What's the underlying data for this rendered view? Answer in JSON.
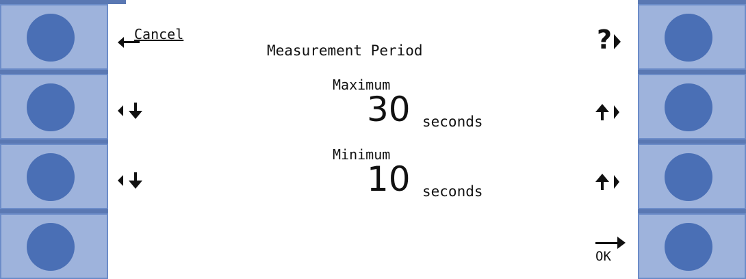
{
  "screen": {
    "cancel_label": "Cancel",
    "title": "Measurement Period",
    "ok_label": "OK",
    "help_label": "?"
  },
  "maximum": {
    "label": "Maximum",
    "value": "30",
    "unit": "seconds"
  },
  "minimum": {
    "label": "Minimum",
    "value": "10",
    "unit": "seconds"
  },
  "icons": {
    "left_row1": "left-arrow-icon",
    "left_row2": "down-arrow-icon",
    "left_row3": "down-arrow-icon",
    "right_row1": "question-mark-icon",
    "right_row2": "up-arrow-icon",
    "right_row3": "up-arrow-icon",
    "right_row4": "ok-arrow-icon"
  },
  "colors": {
    "panel": "#9eb3dc",
    "button": "#4a6fb5",
    "frame": "#5a78b3"
  }
}
